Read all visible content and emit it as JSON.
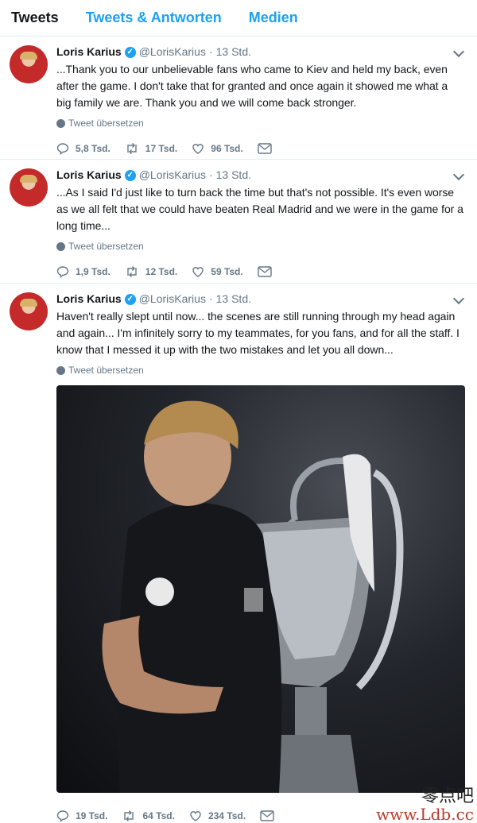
{
  "tabs": [
    {
      "label": "Tweets",
      "active": true
    },
    {
      "label": "Tweets & Antworten",
      "active": false
    },
    {
      "label": "Medien",
      "active": false
    }
  ],
  "tweets": [
    {
      "name": "Loris Karius",
      "handle": "@LorisKarius",
      "separator": "·",
      "time": "13 Std.",
      "text": "...Thank you to our unbelievable fans who came to Kiev and held my back, even after the game. I don't take that for granted and once again it showed me what a big family we are. Thank you and we will come back stronger.",
      "translate": "Tweet übersetzen",
      "replies": "5,8 Tsd.",
      "retweets": "17 Tsd.",
      "likes": "96 Tsd."
    },
    {
      "name": "Loris Karius",
      "handle": "@LorisKarius",
      "separator": "·",
      "time": "13 Std.",
      "text": "...As I said I'd just like to turn back the time but that's not possible. It's even worse as we all felt that we could have beaten Real Madrid and we were in the game for a long time...",
      "translate": "Tweet übersetzen",
      "replies": "1,9 Tsd.",
      "retweets": "12 Tsd.",
      "likes": "59 Tsd."
    },
    {
      "name": "Loris Karius",
      "handle": "@LorisKarius",
      "separator": "·",
      "time": "13 Std.",
      "text": "Haven't really slept until now... the scenes are still running through my head again and again... I'm infinitely sorry to my teammates, for you fans, and for all the staff. I know that I messed it up with the two mistakes and let you all down...",
      "translate": "Tweet übersetzen",
      "replies": "19 Tsd.",
      "retweets": "64 Tsd.",
      "likes": "234 Tsd."
    }
  ],
  "watermark": {
    "cn": "零点吧",
    "url": "www.Ldb.cc"
  },
  "colors": {
    "accent": "#1da1f2",
    "muted": "#657786",
    "border": "#e6ecf0"
  }
}
